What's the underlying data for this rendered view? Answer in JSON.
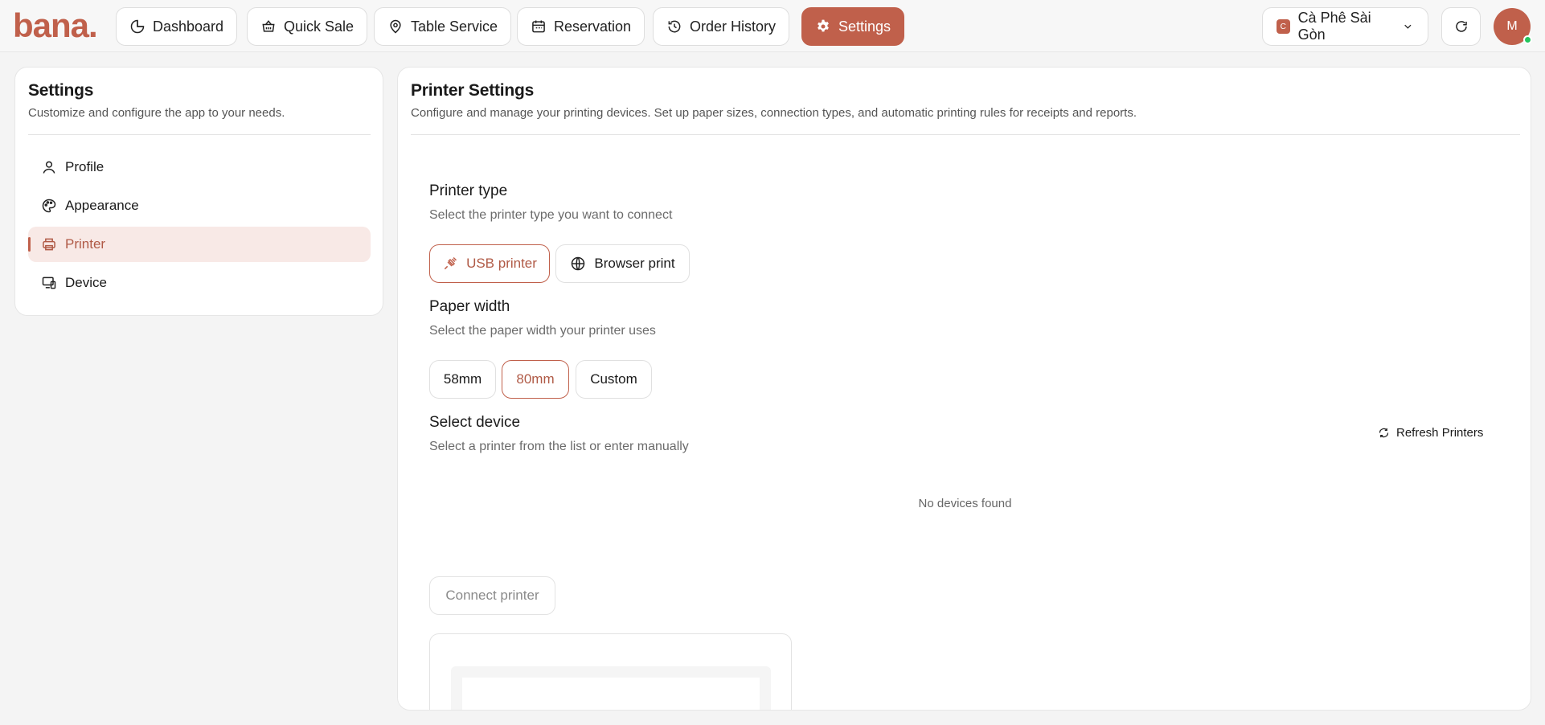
{
  "header": {
    "logo_text": "bana.",
    "nav": [
      {
        "label": "Dashboard",
        "icon": "chart-pie-icon",
        "active": false
      },
      {
        "label": "Quick Sale",
        "icon": "basket-icon",
        "active": false
      },
      {
        "label": "Table Service",
        "icon": "table-service-icon",
        "active": false
      },
      {
        "label": "Reservation",
        "icon": "calendar-icon",
        "active": false
      },
      {
        "label": "Order History",
        "icon": "history-icon",
        "active": false
      },
      {
        "label": "Settings",
        "icon": "gear-icon",
        "active": true
      }
    ],
    "store": {
      "badge": "C",
      "name": "Cà Phê Sài Gòn"
    },
    "avatar_initial": "M"
  },
  "sidebar": {
    "title": "Settings",
    "subtitle": "Customize and configure the app to your needs.",
    "items": [
      {
        "label": "Profile",
        "icon": "user-icon",
        "active": false
      },
      {
        "label": "Appearance",
        "icon": "palette-icon",
        "active": false
      },
      {
        "label": "Printer",
        "icon": "printer-icon",
        "active": true
      },
      {
        "label": "Device",
        "icon": "device-icon",
        "active": false
      }
    ]
  },
  "main": {
    "title": "Printer Settings",
    "subtitle": "Configure and manage your printing devices. Set up paper sizes, connection types, and automatic printing rules for receipts and reports.",
    "printer_type": {
      "title": "Printer type",
      "subtitle": "Select the printer type you want to connect",
      "options": [
        {
          "label": "USB printer",
          "icon": "usb-plug-icon",
          "selected": true
        },
        {
          "label": "Browser print",
          "icon": "globe-icon",
          "selected": false
        }
      ]
    },
    "paper_width": {
      "title": "Paper width",
      "subtitle": "Select the paper width your printer uses",
      "options": [
        {
          "label": "58mm",
          "selected": false
        },
        {
          "label": "80mm",
          "selected": true
        },
        {
          "label": "Custom",
          "selected": false
        }
      ]
    },
    "select_device": {
      "title": "Select device",
      "subtitle": "Select a printer from the list or enter manually",
      "refresh_label": "Refresh Printers",
      "empty_text": "No devices found"
    },
    "connect_label": "Connect printer"
  },
  "colors": {
    "accent": "#c0604b",
    "accent_soft": "#f8e9e6",
    "online": "#22c55e"
  }
}
